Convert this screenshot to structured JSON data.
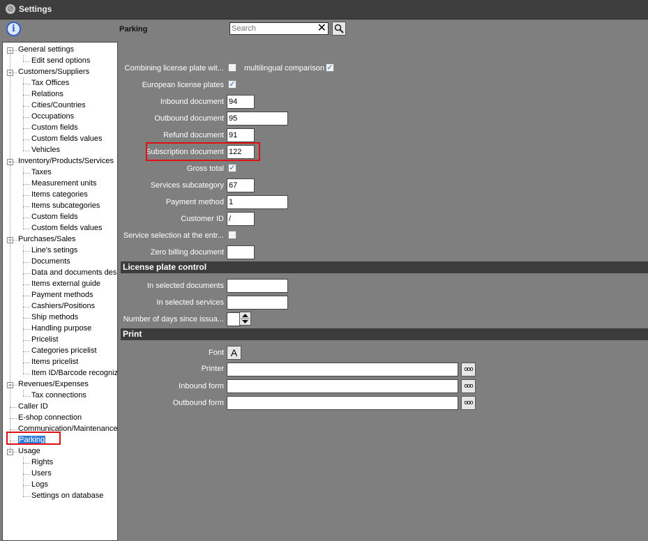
{
  "window": {
    "title": "Settings"
  },
  "header": {
    "page_title": "Parking",
    "search_placeholder": "Search"
  },
  "tree": [
    {
      "label": "General settings",
      "level": 0,
      "expandable": true
    },
    {
      "label": "Edit send options",
      "level": 1
    },
    {
      "label": "Customers/Suppliers",
      "level": 0,
      "expandable": true
    },
    {
      "label": "Tax Offices",
      "level": 1
    },
    {
      "label": "Relations",
      "level": 1
    },
    {
      "label": "Cities/Countries",
      "level": 1
    },
    {
      "label": "Occupations",
      "level": 1
    },
    {
      "label": "Custom fields",
      "level": 1
    },
    {
      "label": "Custom fields values",
      "level": 1
    },
    {
      "label": "Vehicles",
      "level": 1
    },
    {
      "label": "Inventory/Products/Services",
      "level": 0,
      "expandable": true
    },
    {
      "label": "Taxes",
      "level": 1
    },
    {
      "label": "Measurement units",
      "level": 1
    },
    {
      "label": "Items categories",
      "level": 1
    },
    {
      "label": "Items subcategories",
      "level": 1
    },
    {
      "label": "Custom fields",
      "level": 1
    },
    {
      "label": "Custom fields values",
      "level": 1
    },
    {
      "label": "Purchases/Sales",
      "level": 0,
      "expandable": true
    },
    {
      "label": "Line's setings",
      "level": 1
    },
    {
      "label": "Documents",
      "level": 1
    },
    {
      "label": "Data and documents desi",
      "level": 1
    },
    {
      "label": "Items external guide",
      "level": 1
    },
    {
      "label": "Payment methods",
      "level": 1
    },
    {
      "label": "Cashiers/Positions",
      "level": 1
    },
    {
      "label": "Ship methods",
      "level": 1
    },
    {
      "label": "Handling purpose",
      "level": 1
    },
    {
      "label": "Pricelist",
      "level": 1
    },
    {
      "label": "Categories pricelist",
      "level": 1
    },
    {
      "label": "Items pricelist",
      "level": 1
    },
    {
      "label": "Item ID/Barcode recognize",
      "level": 1
    },
    {
      "label": "Revenues/Expenses",
      "level": 0,
      "expandable": true
    },
    {
      "label": "Tax connections",
      "level": 1
    },
    {
      "label": "Caller ID",
      "level": 0
    },
    {
      "label": "E-shop connection",
      "level": 0
    },
    {
      "label": "Communication/Maintenance",
      "level": 0
    },
    {
      "label": "Parking",
      "level": 0,
      "selected": true
    },
    {
      "label": "Usage",
      "level": 0,
      "expandable": true
    },
    {
      "label": "Rights",
      "level": 1
    },
    {
      "label": "Users",
      "level": 1
    },
    {
      "label": "Logs",
      "level": 1
    },
    {
      "label": "Settings on database",
      "level": 1
    }
  ],
  "fields": {
    "combining_label": "Combining license plate wit...",
    "multilingual_label": "multilingual comparison",
    "european_label": "European license plates",
    "inbound_label": "Inbound document",
    "inbound_value": "94",
    "outbound_label": "Outbound document",
    "outbound_value": "95",
    "refund_label": "Refund document",
    "refund_value": "91",
    "subscription_label": "Subscription document",
    "subscription_value": "122",
    "gross_label": "Gross total",
    "services_sub_label": "Services subcategory",
    "services_sub_value": "67",
    "payment_label": "Payment method",
    "payment_value": "1",
    "customer_label": "Customer ID",
    "customer_value": "/",
    "service_sel_label": "Service selection at the entr...",
    "zero_label": "Zero billing document",
    "zero_value": ""
  },
  "checkboxes": {
    "combining": false,
    "multilingual": true,
    "european": true,
    "gross": true,
    "service_sel": false
  },
  "license_section": {
    "title": "License plate control",
    "selected_docs_label": "In selected documents",
    "selected_services_label": "In selected services",
    "days_label": "Number of days since issua..."
  },
  "print_section": {
    "title": "Print",
    "font_label": "Font",
    "font_button": "A",
    "printer_label": "Printer",
    "inbound_form_label": "Inbound form",
    "outbound_form_label": "Outbound form",
    "dots": "ooo"
  }
}
